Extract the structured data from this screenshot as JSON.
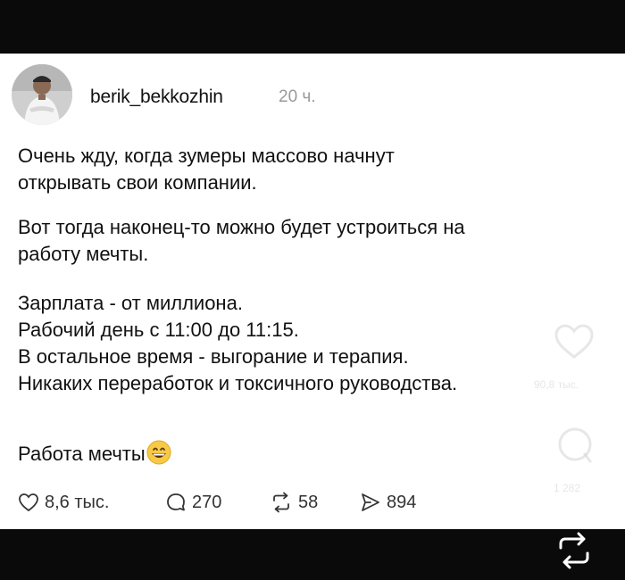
{
  "post": {
    "username": "berik_bekkozhin",
    "timestamp": "20 ч.",
    "paragraphs": {
      "p1_l1": "Очень жду, когда зумеры массово начнут",
      "p1_l2": "открывать свои компании.",
      "p2_l1": "Вот тогда наконец-то можно будет устроиться на",
      "p2_l2": "работу мечты.",
      "p3_l1": "Зарплата - от миллиона.",
      "p3_l2": "Рабочий день с 11:00 до 11:15.",
      "p3_l3": "В остальное время - выгорание и терапия.",
      "p3_l4": "Никаких переработок и токсичного руководства.",
      "p4": "Работа мечты"
    },
    "emoji": "grinning-face-emoji",
    "stats": {
      "likes": "8,6 тыс.",
      "comments": "270",
      "reposts": "58",
      "shares": "894"
    }
  },
  "overlay": {
    "likes": "90,8 тыс.",
    "comments": "1 282"
  },
  "colors": {
    "bar": "#0a0a0a",
    "card": "#ffffff",
    "text": "#111111",
    "muted": "#9a9a9a"
  }
}
